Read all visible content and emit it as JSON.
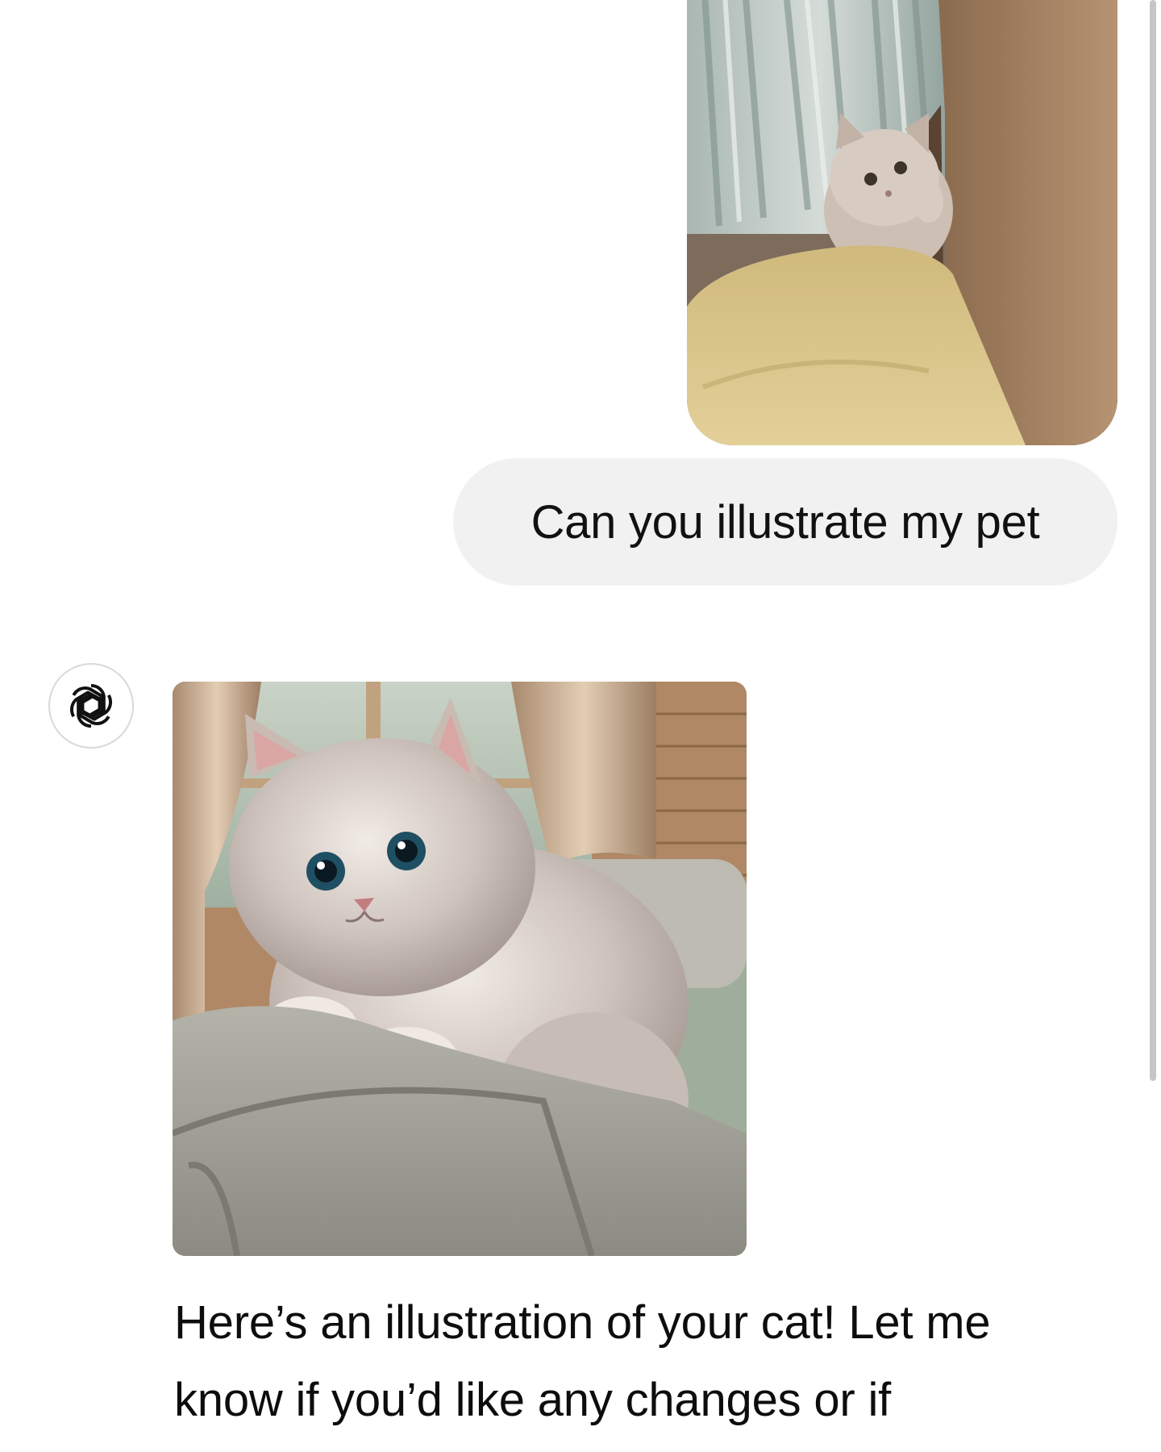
{
  "conversation": {
    "user_message": "Can you illustrate my pet",
    "assistant_reply": "Here’s an illustration of your cat! Let me know if you’d like any changes or if"
  },
  "icons": {
    "assistant_avatar": "openai-logo-icon"
  },
  "colors": {
    "user_bubble": "#f1f1f1",
    "background": "#ffffff",
    "scrollbar": "#c6c6c6"
  }
}
